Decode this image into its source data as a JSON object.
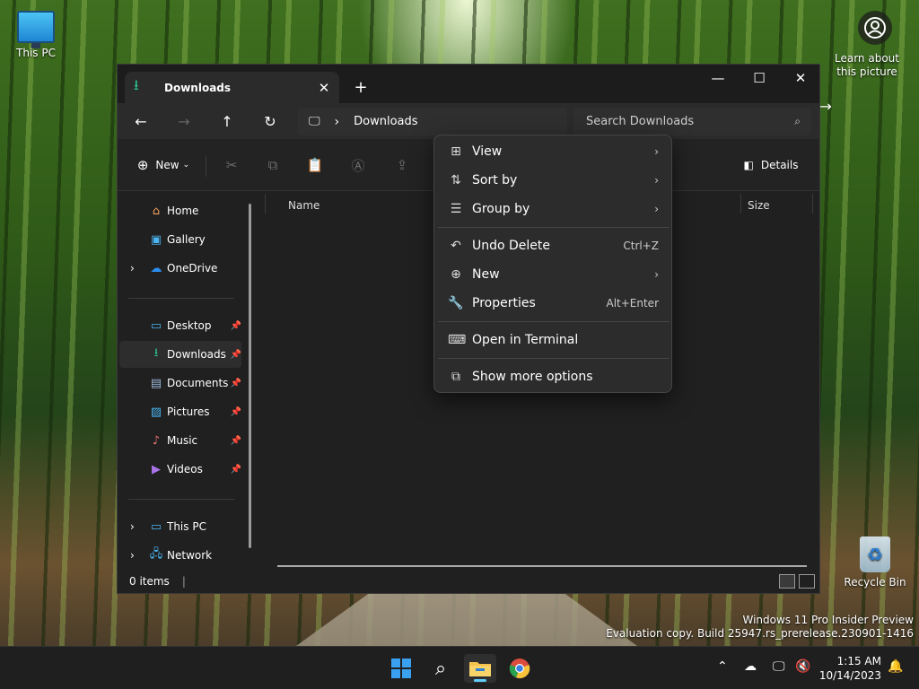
{
  "desktop": {
    "this_pc_label": "This PC",
    "learn_label": "Learn about this picture",
    "recycle_bin_label": "Recycle Bin",
    "watermark_line1": "Windows 11 Pro Insider Preview",
    "watermark_line2": "Evaluation copy. Build 25947.rs_prerelease.230901-1416"
  },
  "window": {
    "tab_title": "Downloads",
    "address_location": "Downloads",
    "search_placeholder": "Search Downloads",
    "toolbar": {
      "new_label": "New",
      "details_label": "Details"
    },
    "sidebar": {
      "home": "Home",
      "gallery": "Gallery",
      "onedrive": "OneDrive",
      "desktop": "Desktop",
      "downloads": "Downloads",
      "documents": "Documents",
      "pictures": "Pictures",
      "music": "Music",
      "videos": "Videos",
      "this_pc": "This PC",
      "network": "Network"
    },
    "columns": {
      "name": "Name",
      "size": "Size"
    },
    "status": "0 items"
  },
  "context_menu": {
    "view": "View",
    "sort_by": "Sort by",
    "group_by": "Group by",
    "undo_delete": "Undo Delete",
    "undo_shortcut": "Ctrl+Z",
    "new": "New",
    "properties": "Properties",
    "properties_shortcut": "Alt+Enter",
    "open_terminal": "Open in Terminal",
    "show_more": "Show more options"
  },
  "taskbar": {
    "time": "1:15 AM",
    "date": "10/14/2023"
  },
  "colors": {
    "accent": "#60cdff",
    "download_green": "#2cc38a"
  }
}
